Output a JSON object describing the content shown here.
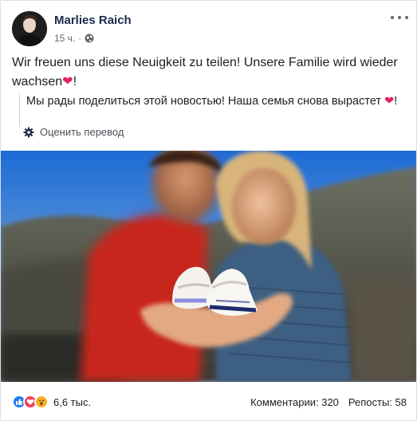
{
  "post": {
    "author": "Marlies Raich",
    "time": "15 ч.",
    "separator": "·",
    "text": "Wir freuen uns diese Neuigkeit zu teilen! Unsere Familie wird wieder wachsen",
    "text_suffix": "!",
    "translation": "Мы рады поделиться этой новостью! Наша семья снова вырастет",
    "translation_suffix": "!",
    "translate_link": "Оценить перевод",
    "heart_emoji": "❤"
  },
  "footer": {
    "reaction_count": "6,6 тыс.",
    "comments": "Комментарии: 320",
    "shares": "Репосты: 58",
    "reactions": [
      "like",
      "love",
      "wow"
    ]
  },
  "colors": {
    "accent_blue": "#2078f4",
    "heart_red": "#e0245e",
    "author_color": "#1c2b4a"
  }
}
